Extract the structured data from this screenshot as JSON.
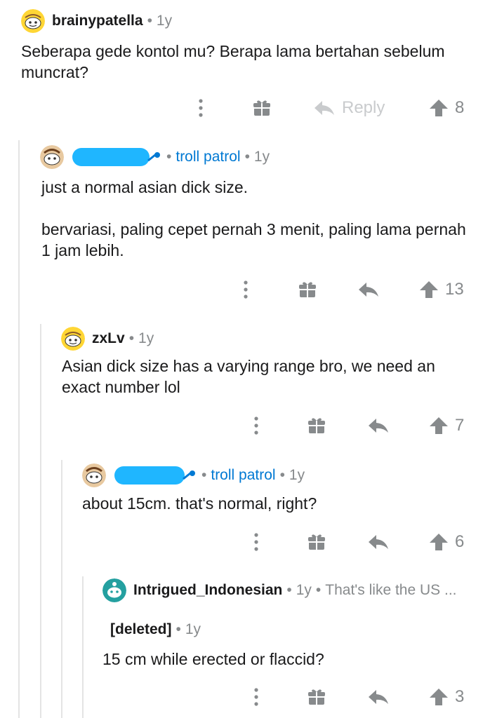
{
  "colors": {
    "username": "#1a1a1b",
    "meta": "#878a8c",
    "flair": "#0079d3",
    "redaction": "#1fb6ff",
    "thread_line": "#e4e4e4",
    "icon": "#878a8c"
  },
  "comments": [
    {
      "username": "brainypatella",
      "separator": "•",
      "age": "1y",
      "avatar_icon": "snoo-avatar-icon",
      "body": [
        "Seberapa gede kontol mu? Berapa lama bertahan sebelum muncrat?"
      ],
      "reply_label": "Reply",
      "score": "8"
    },
    {
      "username_redacted": true,
      "flair": "troll patrol",
      "separator": "•",
      "age": "1y",
      "avatar_icon": "snoo-avatar-icon",
      "body": [
        "just a normal asian dick size.",
        "bervariasi, paling cepet pernah 3 menit, paling lama pernah 1 jam lebih."
      ],
      "score": "13"
    },
    {
      "username": "zxLv",
      "separator": "•",
      "age": "1y",
      "avatar_icon": "snoo-avatar-icon",
      "body": [
        "Asian dick size has a varying range bro, we need an exact number lol"
      ],
      "score": "7"
    },
    {
      "username_redacted": true,
      "flair": "troll patrol",
      "separator": "•",
      "age": "1y",
      "avatar_icon": "snoo-avatar-icon",
      "body": [
        "about 15cm. that's normal, right?"
      ],
      "score": "6"
    },
    {
      "username": "Intrigued_Indonesian",
      "separator": "•",
      "age": "1y",
      "parent_preview": "That's like the US ...",
      "avatar_icon": "snoo-avatar-icon",
      "deleted_user": "[deleted]",
      "deleted_age": "1y",
      "body": [
        "15 cm while erected or flaccid?"
      ],
      "score": "3"
    }
  ]
}
